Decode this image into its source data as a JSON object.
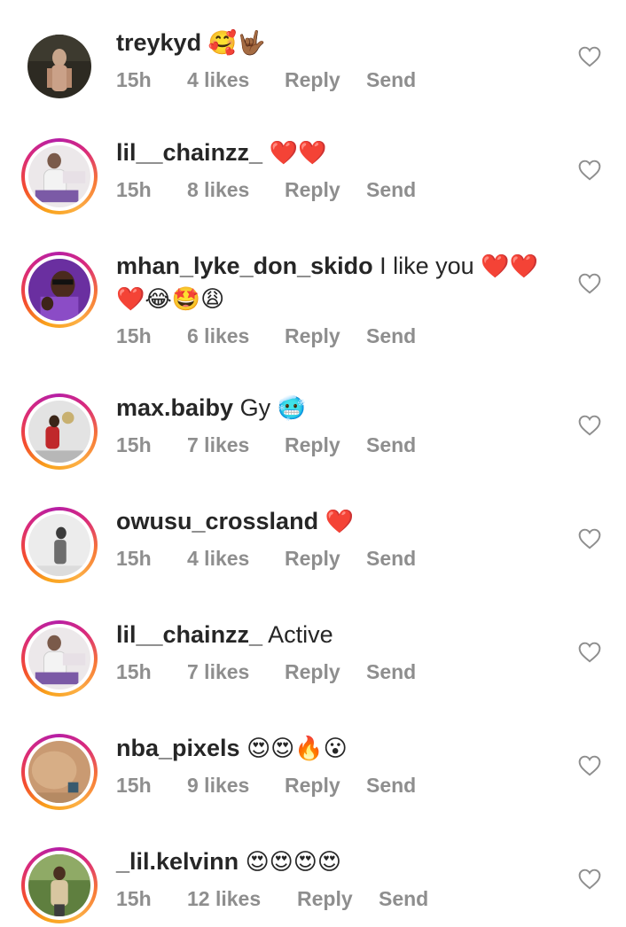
{
  "colors": {
    "text": "#262626",
    "meta": "#8e8e8e",
    "story_ring_start": "#f9a31b",
    "story_ring_end": "#b61fa6"
  },
  "labels": {
    "reply": "Reply",
    "send": "Send"
  },
  "comments": [
    {
      "username": "treykyd",
      "text": "",
      "emoji": "🥰🤟🏾",
      "time": "15h",
      "likes": "4 likes",
      "avatar_icon": "person-photo-icon",
      "story_ring": false
    },
    {
      "username": "lil__chainzz_",
      "text": "",
      "emoji": "❤️❤️",
      "time": "15h",
      "likes": "8 likes",
      "avatar_icon": "person-photo-icon",
      "story_ring": true
    },
    {
      "username": "mhan_lyke_don_skido",
      "text": "I like you",
      "emoji": "❤️❤️ ❤️😂🤩😩",
      "time": "15h",
      "likes": "6 likes",
      "avatar_icon": "person-photo-icon",
      "story_ring": true
    },
    {
      "username": "max.baiby",
      "text": "Gy",
      "emoji": "🥶",
      "time": "15h",
      "likes": "7 likes",
      "avatar_icon": "person-photo-icon",
      "story_ring": true
    },
    {
      "username": "owusu_crossland",
      "text": "",
      "emoji": "❤️",
      "time": "15h",
      "likes": "4 likes",
      "avatar_icon": "person-photo-icon",
      "story_ring": true
    },
    {
      "username": "lil__chainzz_",
      "text": "Active",
      "emoji": "",
      "time": "15h",
      "likes": "7 likes",
      "avatar_icon": "person-photo-icon",
      "story_ring": true
    },
    {
      "username": "nba_pixels",
      "text": "",
      "emoji": "😍😍🔥😮",
      "time": "15h",
      "likes": "9 likes",
      "avatar_icon": "person-photo-icon",
      "story_ring": true
    },
    {
      "username": "_lil.kelvinn",
      "text": "",
      "emoji": "😍😍😍😍",
      "time": "15h",
      "likes": "12 likes",
      "avatar_icon": "person-photo-icon",
      "story_ring": true
    }
  ]
}
